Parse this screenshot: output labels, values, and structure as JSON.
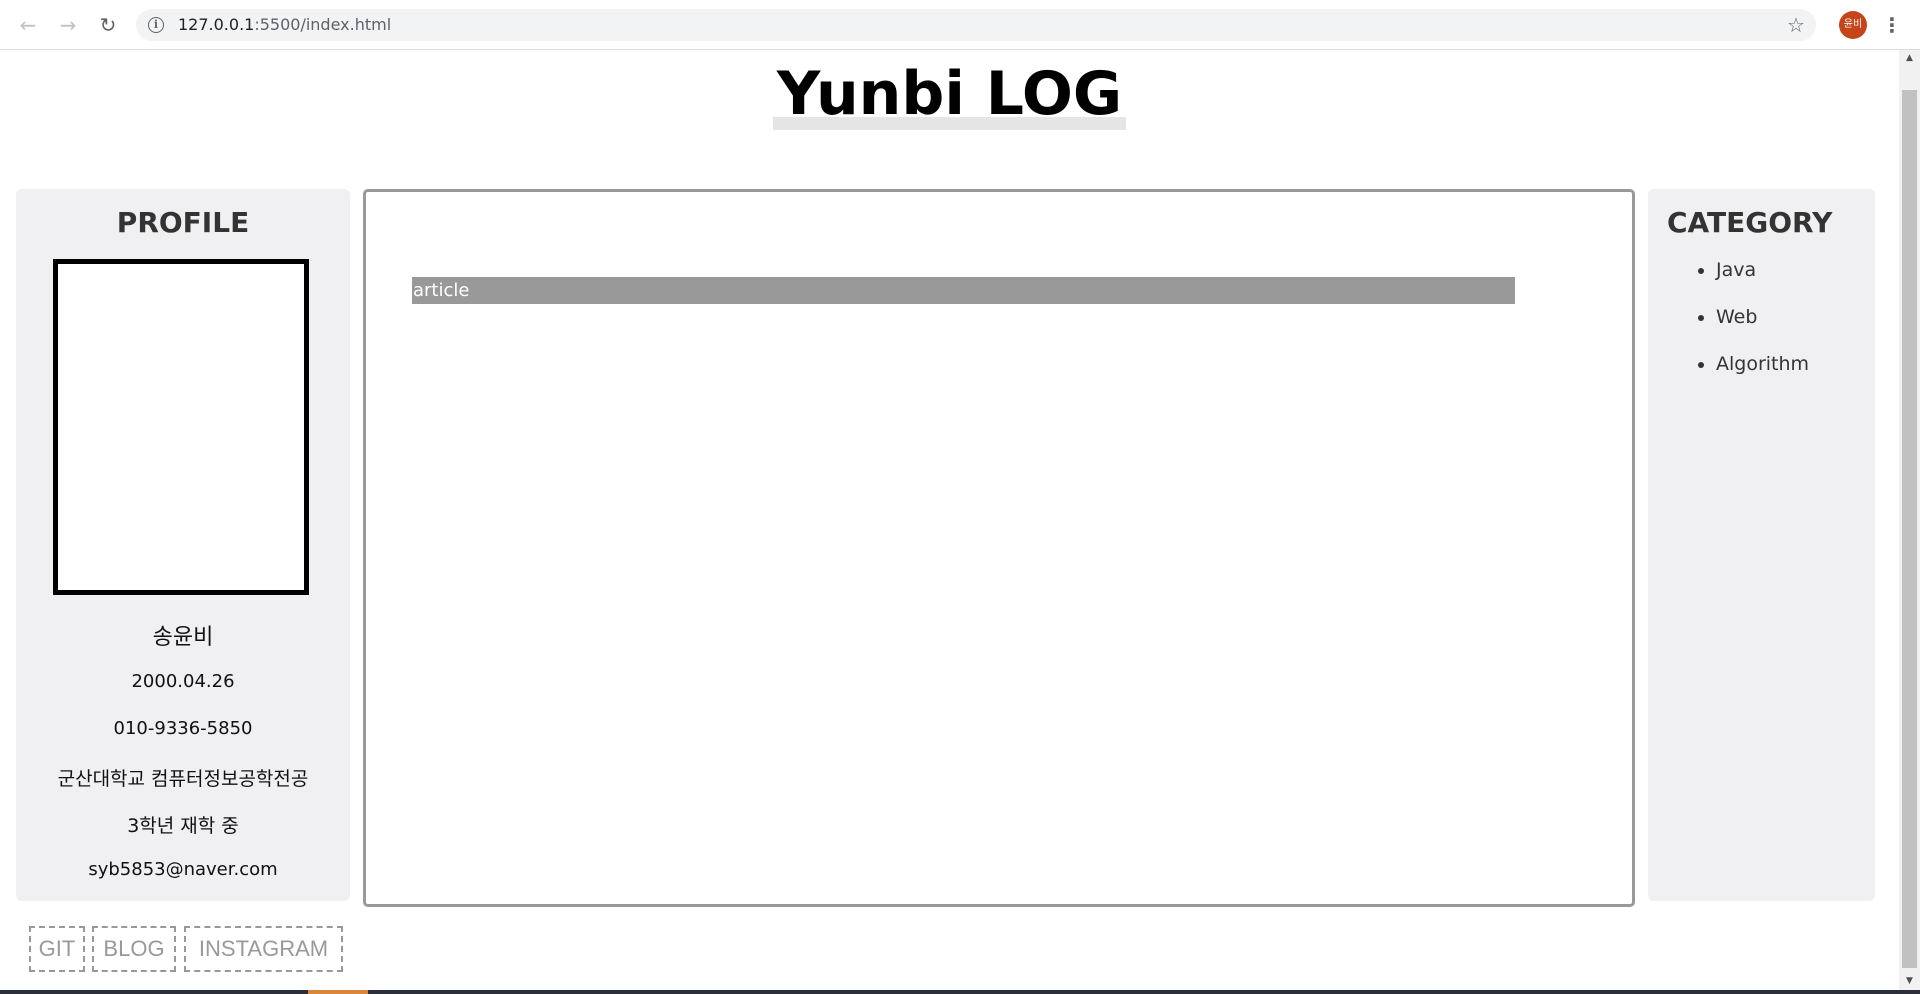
{
  "browser": {
    "url_host": "127.0.0.1",
    "url_rest": ":5500/index.html",
    "profile_initials": "윤비"
  },
  "icons": {
    "back": "back-arrow-icon",
    "forward": "forward-arrow-icon",
    "reload": "reload-icon",
    "info": "info-icon",
    "bookmark": "star-icon",
    "menu": "kebab-menu-icon"
  },
  "header": {
    "title": "Yunbi LOG"
  },
  "profile": {
    "heading": "PROFILE",
    "name": "송윤비",
    "birth": "2000.04.26",
    "phone": "010-9336-5850",
    "school": "군산대학교 컴퓨터정보공학전공",
    "year": "3학년 재학 중",
    "email": "syb5853@naver.com"
  },
  "main": {
    "article_label": "article"
  },
  "category": {
    "heading": "CATEGORY",
    "items": [
      "Java",
      "Web",
      "Algorithm"
    ]
  },
  "links": {
    "git": "GIT",
    "blog": "BLOG",
    "instagram": "INSTAGRAM"
  },
  "colors": {
    "panel_bg": "#f0f0f3",
    "article_bar": "#999999",
    "main_border": "#999999",
    "avatar": "#c5441a"
  }
}
